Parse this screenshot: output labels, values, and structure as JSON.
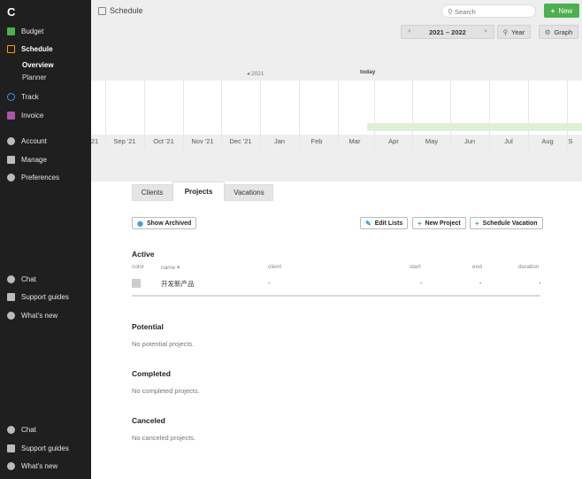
{
  "app": {
    "logo": "C"
  },
  "sidebar": {
    "nav": [
      {
        "label": "Budget",
        "icon": "budget-icon",
        "color": "#4caf50"
      },
      {
        "label": "Schedule",
        "icon": "schedule-icon",
        "color": "#f39c12"
      },
      {
        "label": "Track",
        "icon": "track-icon",
        "color": "#3498db"
      },
      {
        "label": "Invoice",
        "icon": "invoice-icon",
        "color": "#a855a8"
      },
      {
        "label": "Account",
        "icon": "user-icon"
      },
      {
        "label": "Manage",
        "icon": "list-icon"
      },
      {
        "label": "Preferences",
        "icon": "gear-icon"
      }
    ],
    "schedule_sub": [
      "Overview",
      "Planner"
    ],
    "help_upper": [
      "Chat",
      "Support guides",
      "What's new"
    ],
    "help_lower": [
      "Chat",
      "Support guides",
      "What's new"
    ]
  },
  "header": {
    "title": "Schedule",
    "search_placeholder": "Search",
    "new_label": "New"
  },
  "timeline": {
    "year_range": "2021 – 2022",
    "year_button": "Year",
    "graph_button": "Graph",
    "year_label": "2021",
    "today_label": "today",
    "months": [
      "21",
      "Sep '21",
      "Oct '21",
      "Nov '21",
      "Dec '21",
      "Jan",
      "Feb",
      "Mar",
      "Apr",
      "May",
      "Jun",
      "Jul",
      "Aug",
      "S"
    ]
  },
  "tabs": [
    "Clients",
    "Projects",
    "Vacations"
  ],
  "active_tab": "Projects",
  "actions": {
    "show_archived": "Show Archived",
    "edit_lists": "Edit Lists",
    "new_project": "New Project",
    "schedule_vacation": "Schedule Vacation"
  },
  "sections": {
    "active": {
      "title": "Active",
      "columns": [
        "color",
        "name ▾",
        "client",
        "start",
        "end",
        "duration"
      ],
      "rows": [
        {
          "name": "开发新产品",
          "client": "-",
          "start": "-",
          "end": "-",
          "duration": "-"
        }
      ]
    },
    "potential": {
      "title": "Potential",
      "empty": "No potential projects."
    },
    "completed": {
      "title": "Completed",
      "empty": "No completed projects."
    },
    "canceled": {
      "title": "Canceled",
      "empty": "No canceled projects."
    }
  }
}
